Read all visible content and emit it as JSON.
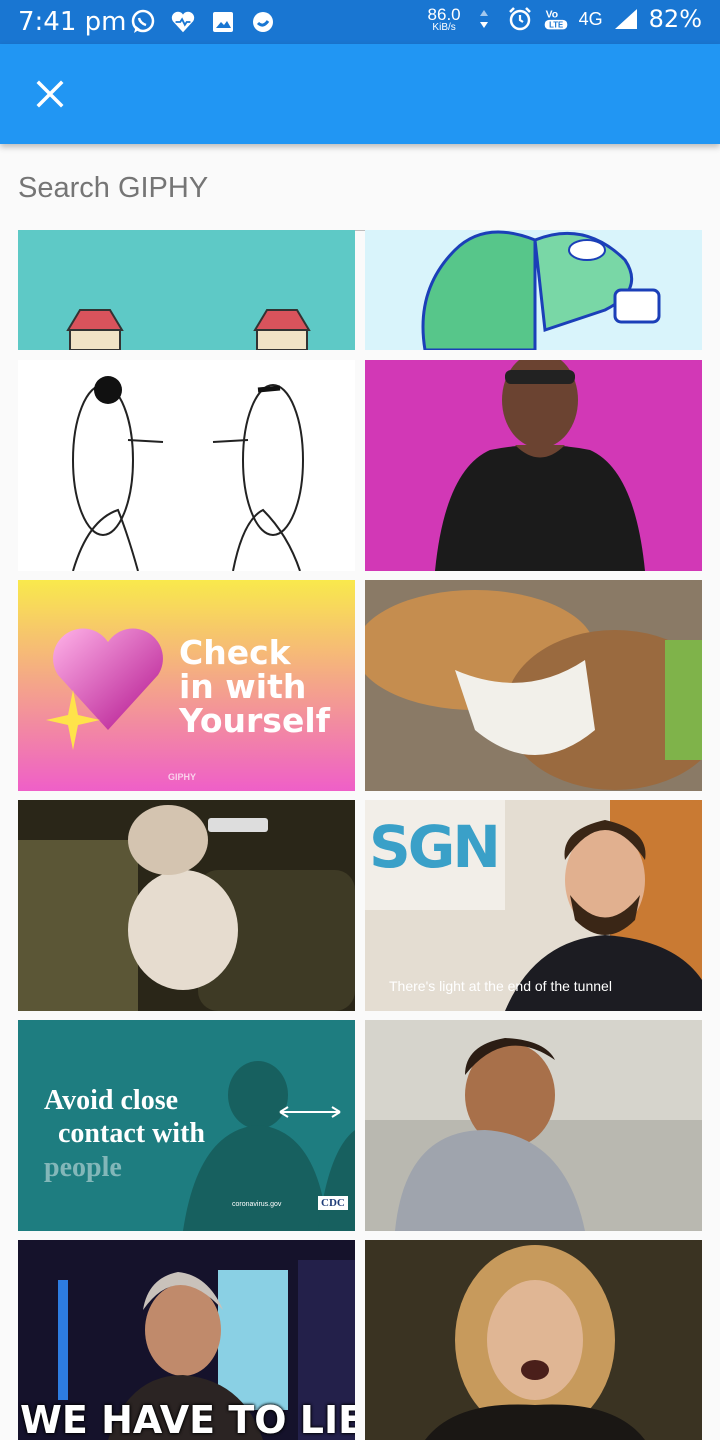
{
  "status_bar": {
    "time": "7:41 pm",
    "speed_value": "86.0",
    "speed_unit": "KiB/s",
    "volte": "Vo LTE",
    "network": "4G",
    "battery": "82%"
  },
  "search": {
    "placeholder": "Search GIPHY"
  },
  "gifs": [
    {
      "caption": ""
    },
    {
      "caption": ""
    },
    {
      "caption": ""
    },
    {
      "caption": ""
    },
    {
      "caption_line1": "Check",
      "caption_line2": "in with",
      "caption_line3": "Yourself",
      "watermark": "GIPHY"
    },
    {
      "caption": ""
    },
    {
      "caption": ""
    },
    {
      "caption": "There's light at the end of the tunnel",
      "logo": "SGN"
    },
    {
      "caption_line1": "Avoid close",
      "caption_line2": "contact with",
      "caption_line3": "people",
      "source": "coronavirus.gov",
      "badge": "CDC"
    },
    {
      "caption": ""
    },
    {
      "caption": "WE HAVE TO LIE"
    },
    {
      "caption": ""
    }
  ],
  "colors": {
    "status_bar": "#1976d2",
    "app_bar": "#2196f3",
    "background": "#fafafa"
  }
}
